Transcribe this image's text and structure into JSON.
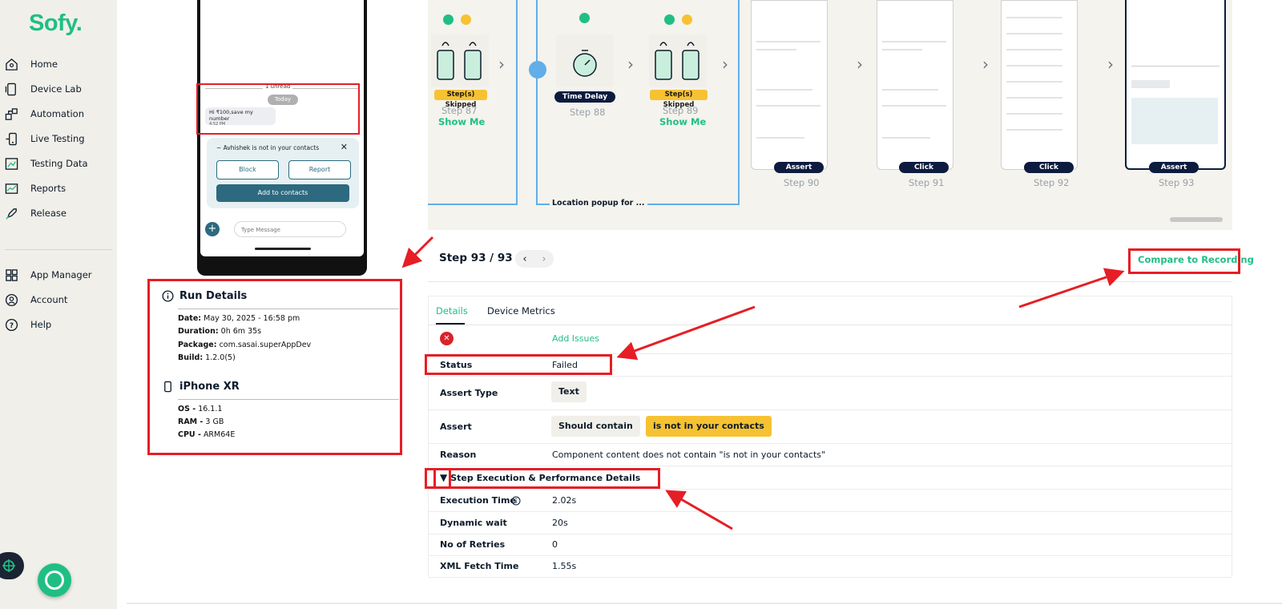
{
  "app": {
    "logo": "Sofy."
  },
  "sidebar": {
    "items": [
      {
        "label": "Home",
        "icon": "home-icon"
      },
      {
        "label": "Device Lab",
        "icon": "device-icon"
      },
      {
        "label": "Automation",
        "icon": "automation-icon"
      },
      {
        "label": "Live Testing",
        "icon": "live-testing-icon"
      },
      {
        "label": "Testing Data",
        "icon": "testing-data-icon"
      },
      {
        "label": "Reports",
        "icon": "reports-icon"
      },
      {
        "label": "Release",
        "icon": "rocket-icon"
      }
    ],
    "bottom_items": [
      {
        "label": "App Manager",
        "icon": "grid-icon"
      },
      {
        "label": "Account",
        "icon": "account-icon"
      },
      {
        "label": "Help",
        "icon": "help-icon"
      }
    ]
  },
  "device_preview": {
    "unread": "1 unread",
    "today": "Today",
    "message": "Hi ₹100,save my number",
    "message_time": "4:52 PM",
    "contact_notice": "~ Avhishek is not in your contacts",
    "block": "Block",
    "report": "Report",
    "add_to_contacts": "Add to contacts",
    "type_placeholder": "Type Message"
  },
  "run_details": {
    "title": "Run Details",
    "date_label": "Date:",
    "date": "May 30, 2025 - 16:58 pm",
    "duration_label": "Duration:",
    "duration": "0h 6m 35s",
    "package_label": "Package:",
    "package": "com.sasai.superAppDev",
    "build_label": "Build:",
    "build": "1.2.0(5)"
  },
  "device": {
    "name": "iPhone XR",
    "os_label": "OS -",
    "os": "16.1.1",
    "ram_label": "RAM -",
    "ram": "3 GB",
    "cpu_label": "CPU -",
    "cpu": "ARM64E"
  },
  "steps_strip": {
    "loop_caption": "Location popup for ...",
    "steps": [
      {
        "label": "Step 87",
        "chip": "Step(s) Skipped",
        "link": "Show Me"
      },
      {
        "label": "Step 88",
        "chip": "Time Delay"
      },
      {
        "label": "Step 89",
        "chip": "Step(s) Skipped",
        "link": "Show Me"
      },
      {
        "label": "Step 90",
        "chip": "Assert"
      },
      {
        "label": "Step 91",
        "chip": "Click"
      },
      {
        "label": "Step 92",
        "chip": "Click"
      },
      {
        "label": "Step 93",
        "chip": "Assert"
      }
    ]
  },
  "step_header": {
    "title": "Step 93 / 93",
    "compare": "Compare to Recording"
  },
  "tabs": [
    "Details",
    "Device Metrics"
  ],
  "details": {
    "add_issues": "Add Issues",
    "status_label": "Status",
    "status": "Failed",
    "assert_type_label": "Assert Type",
    "assert_type": "Text",
    "assert_label": "Assert",
    "assert_op": "Should contain",
    "assert_value": "is not in your contacts",
    "reason_label": "Reason",
    "reason": "Component content does not contain \"is not in your contacts\"",
    "perf_toggle": "Step Execution & Performance Details",
    "exec_time_label": "Execution Time",
    "exec_time": "2.02s",
    "dynamic_wait_label": "Dynamic wait",
    "dynamic_wait": "20s",
    "retries_label": "No of Retries",
    "retries": "0",
    "xml_label": "XML Fetch Time",
    "xml": "1.55s"
  },
  "colors": {
    "brand": "#1fbf84",
    "annotation": "#e61e25",
    "status_failed": "#d8232a",
    "chip_amber": "#f7c232",
    "chip_dark": "#0d1b3e",
    "loop_frame": "#61aee8"
  }
}
